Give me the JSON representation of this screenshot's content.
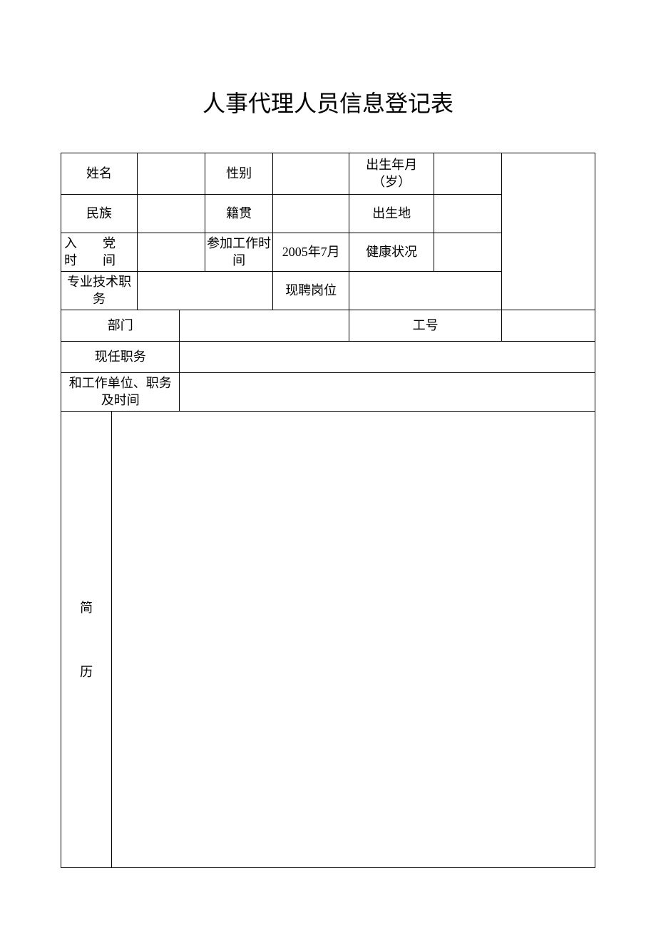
{
  "title": "人事代理人员信息登记表",
  "labels": {
    "name": "姓名",
    "gender": "性别",
    "birth": "出生年月（岁）",
    "ethnicity": "民族",
    "native_place": "籍贯",
    "birthplace": "出生地",
    "party_join_c1": "入",
    "party_join_c2": "党",
    "party_join_c3": "时",
    "party_join_c4": "间",
    "work_start": "参加工作时间",
    "health": "健康状况",
    "tech_title": "专业技术职务",
    "current_post": "现聘岗位",
    "department": "部门",
    "emp_id": "工号",
    "current_position": "现任职务",
    "work_unit_position": "和工作单位、职务及时间",
    "resume_c1": "简",
    "resume_c2": "历"
  },
  "values": {
    "name": "",
    "gender": "",
    "birth": "",
    "ethnicity": "",
    "native_place": "",
    "birthplace": "",
    "party_join": "",
    "work_start": "2005年7月",
    "health": "",
    "tech_title": "",
    "current_post": "",
    "department": "",
    "emp_id": "",
    "current_position": "",
    "work_unit_position": "",
    "resume": ""
  }
}
